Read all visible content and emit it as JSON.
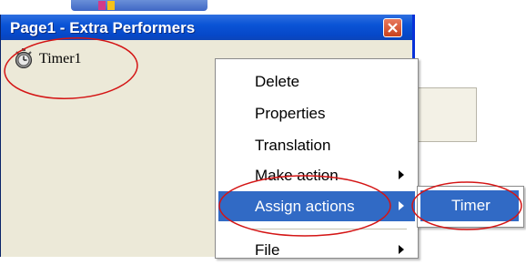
{
  "window": {
    "title": "Page1 - Extra Performers",
    "close_icon": "close-icon"
  },
  "panel": {
    "items": [
      {
        "label": "Timer1",
        "icon": "stopwatch-icon"
      }
    ]
  },
  "context_menu": {
    "items": [
      {
        "label": "Delete",
        "submenu": false
      },
      {
        "label": "Properties",
        "submenu": false
      },
      {
        "label": "Translation",
        "submenu": false
      },
      {
        "label": "Make action",
        "submenu": true
      },
      {
        "label": "Assign actions",
        "submenu": true,
        "highlighted": true
      },
      {
        "label": "File",
        "submenu": true
      }
    ]
  },
  "submenu": {
    "items": [
      {
        "label": "Timer",
        "highlighted": true
      }
    ]
  },
  "colors": {
    "titlebar": "#0a54d6",
    "highlight": "#316ac5",
    "panel_bg": "#ece9d8",
    "annotation": "#d41515"
  }
}
